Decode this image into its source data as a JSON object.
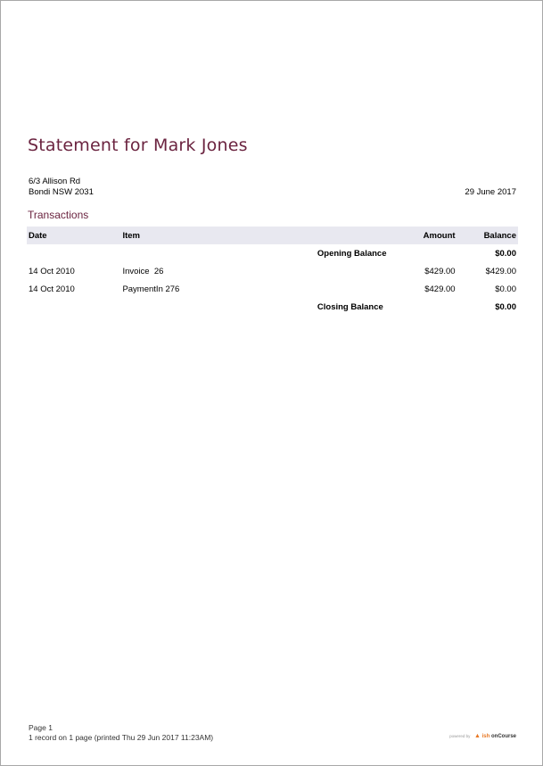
{
  "title": "Statement for Mark Jones",
  "address": {
    "line1": "6/3 Allison Rd",
    "line2": "Bondi NSW 2031"
  },
  "statement_date": "29 June 2017",
  "section_title": "Transactions",
  "table": {
    "headers": {
      "date": "Date",
      "item": "Item",
      "amount": "Amount",
      "balance": "Balance"
    },
    "opening": {
      "label": "Opening Balance",
      "balance": "$0.00"
    },
    "rows": [
      {
        "date": "14 Oct 2010",
        "item": "Invoice  26",
        "amount": "$429.00",
        "balance": "$429.00"
      },
      {
        "date": "14 Oct 2010",
        "item": "PaymentIn 276",
        "amount": "$429.00",
        "balance": "$0.00"
      }
    ],
    "closing": {
      "label": "Closing Balance",
      "balance": "$0.00"
    }
  },
  "footer": {
    "page": "Page 1",
    "records": "1 record on 1 page (printed Thu 29 Jun 2017 11:23AM)"
  },
  "brand": {
    "powered": "powered by",
    "ish": "ish",
    "oncourse": "onCourse"
  },
  "colors": {
    "heading": "#6b2440",
    "table_header_bg": "#e8e8f0",
    "brand_orange": "#e87722"
  }
}
